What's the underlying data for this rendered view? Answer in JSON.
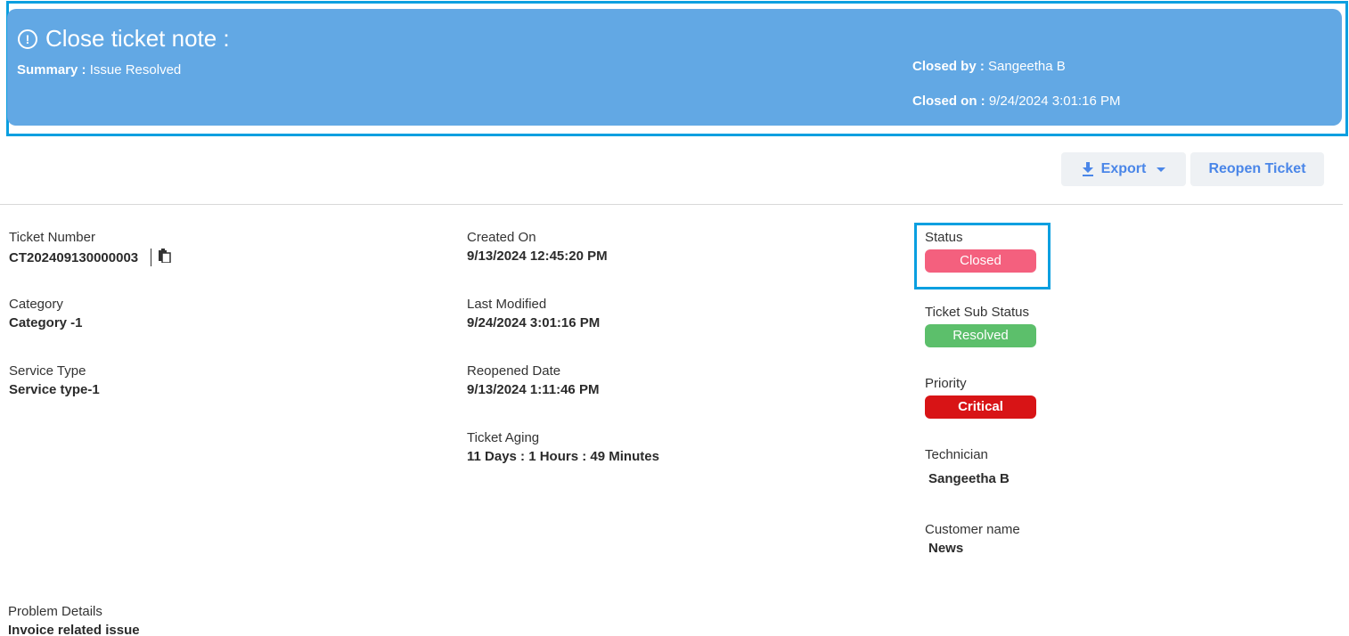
{
  "note": {
    "title": "Close ticket note :",
    "summary_label": "Summary :",
    "summary_value": "Issue Resolved",
    "closed_by_label": "Closed by :",
    "closed_by_value": "Sangeetha B",
    "closed_on_label": "Closed on :",
    "closed_on_value": "9/24/2024 3:01:16 PM",
    "icon": "alert-circle-icon"
  },
  "toolbar": {
    "export_label": "Export",
    "reopen_label": "Reopen Ticket"
  },
  "fields": {
    "ticket_number": {
      "label": "Ticket Number",
      "value": "CT202409130000003"
    },
    "category": {
      "label": "Category",
      "value": "Category -1"
    },
    "service_type": {
      "label": "Service Type",
      "value": "Service type-1"
    },
    "created_on": {
      "label": "Created On",
      "value": "9/13/2024 12:45:20 PM"
    },
    "last_modified": {
      "label": "Last Modified",
      "value": "9/24/2024 3:01:16 PM"
    },
    "reopened_date": {
      "label": "Reopened Date",
      "value": "9/13/2024 1:11:46 PM"
    },
    "ticket_aging": {
      "label": "Ticket Aging",
      "value": "11 Days : 1 Hours : 49 Minutes"
    },
    "status": {
      "label": "Status",
      "value": "Closed"
    },
    "sub_status": {
      "label": "Ticket Sub Status",
      "value": "Resolved"
    },
    "priority": {
      "label": "Priority",
      "value": "Critical"
    },
    "technician": {
      "label": "Technician",
      "value": "Sangeetha B"
    },
    "customer_name": {
      "label": "Customer name",
      "value": "News"
    },
    "problem_details": {
      "label": "Problem Details",
      "value": "Invoice related issue"
    }
  },
  "colors": {
    "banner": "#62a8e4",
    "highlight_border": "#0a9fe0",
    "status_closed": "#f4607e",
    "status_resolved": "#5cbf6b",
    "priority_critical": "#d81416",
    "button_text": "#4a86e8"
  }
}
